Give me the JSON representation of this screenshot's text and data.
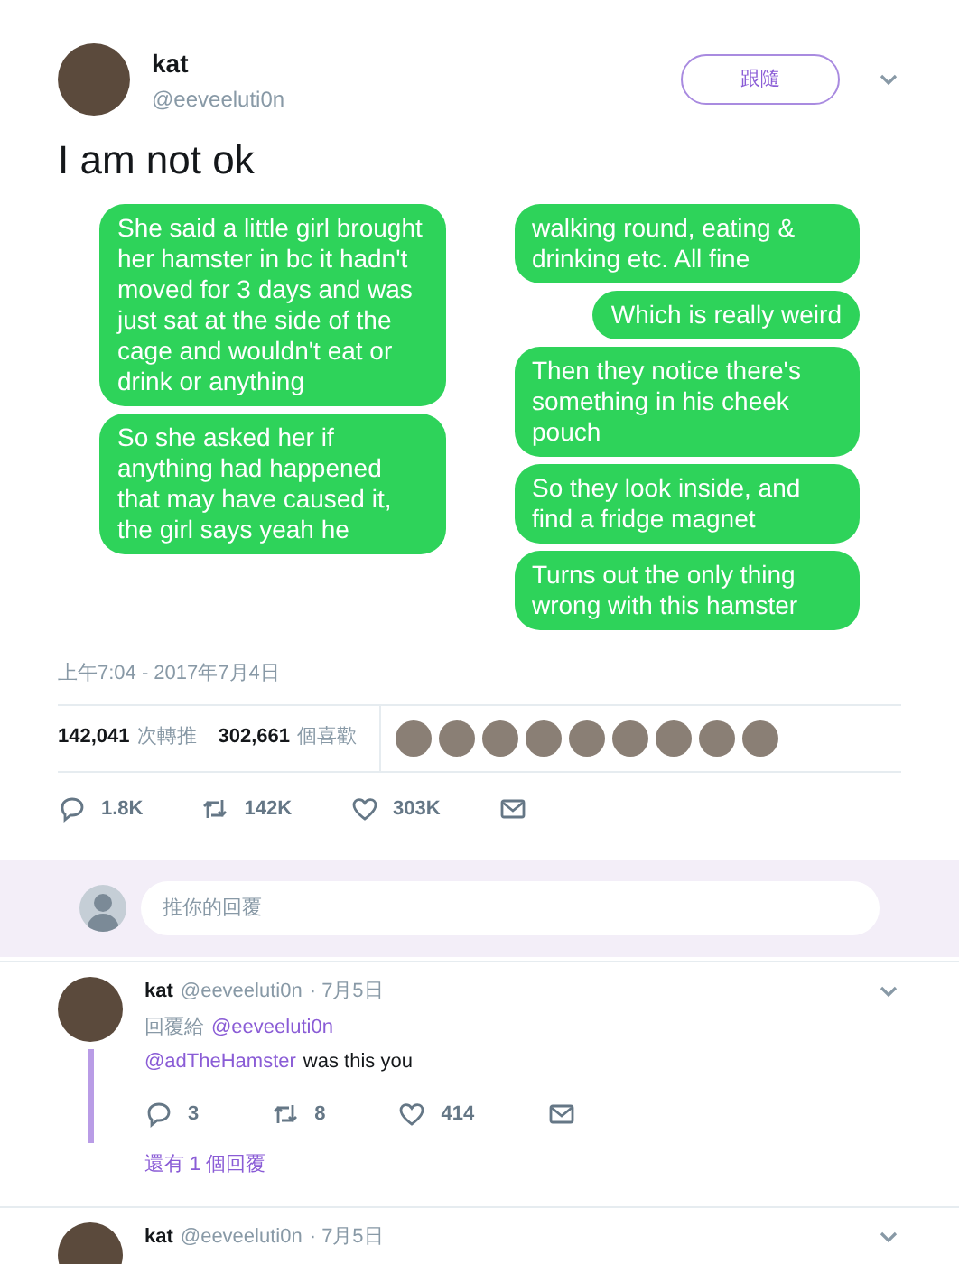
{
  "tweet": {
    "name": "kat",
    "handle": "@eeveeluti0n",
    "follow_button": "跟隨",
    "text": "I am not ok"
  },
  "chat_image": {
    "columns": [
      {
        "bubbles": [
          "She said a little girl brought her hamster in bc it hadn't moved for 3 days and was just sat at the side of the cage and wouldn't eat or drink or anything",
          "So she asked her if anything had happened that may have caused it, the girl says yeah he"
        ]
      },
      {
        "bubbles": [
          "walking round, eating & drinking etc. All fine",
          "Which is really weird",
          "Then they notice there's something in his cheek pouch",
          "So they look inside, and find a fridge magnet",
          "Turns out the only thing wrong with this hamster"
        ]
      }
    ]
  },
  "timestamp": "上午7:04 - 2017年7月4日",
  "stats": [
    {
      "count": "142,041",
      "label": "次轉推"
    },
    {
      "count": "302,661",
      "label": "個喜歡"
    }
  ],
  "actions": [
    {
      "kind": "reply",
      "count": "1.8K"
    },
    {
      "kind": "retweet",
      "count": "142K"
    },
    {
      "kind": "like",
      "count": "303K"
    },
    {
      "kind": "message"
    }
  ],
  "reply_box": {
    "placeholder": "推你的回覆"
  },
  "replies": [
    {
      "name": "kat",
      "handle": "@eeveeluti0n",
      "date": "· 7月5日",
      "reply_to_label": "回覆給",
      "reply_to_handle": "@eeveeluti0n",
      "mention": "@adTheHamster",
      "text": "was this you",
      "actions": [
        {
          "kind": "reply",
          "count": "3"
        },
        {
          "kind": "retweet",
          "count": "8"
        },
        {
          "kind": "like",
          "count": "414"
        },
        {
          "kind": "message"
        }
      ],
      "more_replies": "還有 1 個回覆"
    },
    {
      "name": "kat",
      "handle": "@eeveeluti0n",
      "date": "· 7月5日"
    }
  ]
}
